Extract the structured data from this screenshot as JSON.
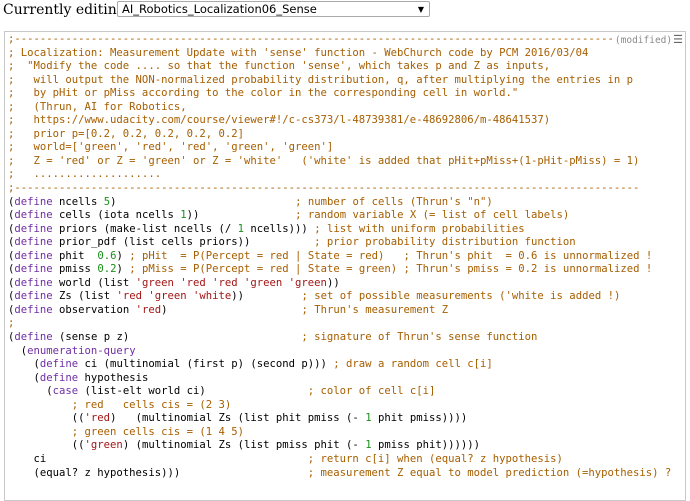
{
  "header": {
    "label": "Currently editing:",
    "selected_file": "AI_Robotics_Localization06_Sense",
    "dropdown_arrow": "▼"
  },
  "editor": {
    "status": "(modified)",
    "menu_icon": "hamburger-menu-icon",
    "menu_glyph": "☰",
    "colors": {
      "comment": "#a65e00",
      "keyword": "#6f2ea3",
      "number": "#1a8f1a",
      "quoted": "#a31515",
      "text": "#000000"
    },
    "lines": [
      [
        [
          "c",
          ";----------------------------------------------------------------------------------------------"
        ]
      ],
      [
        [
          "c",
          "; Localization: Measurement Update with 'sense' function - WebChurch code by PCM 2016/03/04"
        ]
      ],
      [
        [
          "c",
          ";  \"Modify the code .... so that the function 'sense', which takes p and Z as inputs,"
        ]
      ],
      [
        [
          "c",
          ";   will output the NON-normalized probability distribution, q, after multiplying the entries in p"
        ]
      ],
      [
        [
          "c",
          ";   by pHit or pMiss according to the color in the corresponding cell in world.\""
        ]
      ],
      [
        [
          "c",
          ";   (Thrun, AI for Robotics,"
        ]
      ],
      [
        [
          "c",
          ";   https://www.udacity.com/course/viewer#!/c-cs373/l-48739381/e-48692806/m-48641537)"
        ]
      ],
      [
        [
          "c",
          ";   prior p=[0.2, 0.2, 0.2, 0.2, 0.2]"
        ]
      ],
      [
        [
          "c",
          ";   world=['green', 'red', 'red', 'green', 'green']"
        ]
      ],
      [
        [
          "c",
          ";   Z = 'red' or Z = 'green' or Z = 'white'   ('white' is added that pHit+pMiss+(1-pHit-pMiss) = 1)"
        ]
      ],
      [
        [
          "c",
          ";   ...................."
        ]
      ],
      [
        [
          "c",
          ";--------------------------------------------------------------------------------------------------"
        ]
      ],
      [
        [
          "t",
          "("
        ],
        [
          "k",
          "define"
        ],
        [
          "t",
          " ncells "
        ],
        [
          "n",
          "5"
        ],
        [
          "t",
          ")                            "
        ],
        [
          "c",
          "; number of cells (Thrun's \"n\")"
        ]
      ],
      [
        [
          "t",
          "("
        ],
        [
          "k",
          "define"
        ],
        [
          "t",
          " cells (iota ncells "
        ],
        [
          "n",
          "1"
        ],
        [
          "t",
          "))               "
        ],
        [
          "c",
          "; random variable X (= list of cell labels)"
        ]
      ],
      [
        [
          "t",
          "("
        ],
        [
          "k",
          "define"
        ],
        [
          "t",
          " priors (make-list ncells (/ "
        ],
        [
          "n",
          "1"
        ],
        [
          "t",
          " ncells))) "
        ],
        [
          "c",
          "; list with uniform probabilities"
        ]
      ],
      [
        [
          "t",
          "("
        ],
        [
          "k",
          "define"
        ],
        [
          "t",
          " prior_pdf (list cells priors))          "
        ],
        [
          "c",
          "; prior probability distribution function"
        ]
      ],
      [
        [
          "t",
          "("
        ],
        [
          "k",
          "define"
        ],
        [
          "t",
          " phit  "
        ],
        [
          "n",
          "0.6"
        ],
        [
          "t",
          ") "
        ],
        [
          "c",
          "; pHit  = P(Percept = red | State = red)   ; Thrun's phit  = 0.6 is unnormalized !"
        ]
      ],
      [
        [
          "t",
          "("
        ],
        [
          "k",
          "define"
        ],
        [
          "t",
          " pmiss "
        ],
        [
          "n",
          "0.2"
        ],
        [
          "t",
          ") "
        ],
        [
          "c",
          "; pMiss = P(Percept = red | State = green) ; Thrun's pmiss = 0.2 is unnormalized !"
        ]
      ],
      [
        [
          "t",
          "("
        ],
        [
          "k",
          "define"
        ],
        [
          "t",
          " world (list "
        ],
        [
          "q",
          "'green 'red 'red 'green 'green"
        ],
        [
          "t",
          "))"
        ]
      ],
      [
        [
          "t",
          "("
        ],
        [
          "k",
          "define"
        ],
        [
          "t",
          " Zs (list "
        ],
        [
          "q",
          "'red 'green 'white"
        ],
        [
          "t",
          "))         "
        ],
        [
          "c",
          "; set of possible measurements ('white is added !)"
        ]
      ],
      [
        [
          "t",
          "("
        ],
        [
          "k",
          "define"
        ],
        [
          "t",
          " observation "
        ],
        [
          "q",
          "'red"
        ],
        [
          "t",
          ")                     "
        ],
        [
          "c",
          "; Thrun's measurement Z"
        ]
      ],
      [
        [
          "c",
          ";"
        ]
      ],
      [
        [
          "t",
          "("
        ],
        [
          "k",
          "define"
        ],
        [
          "t",
          " (sense p z)                           "
        ],
        [
          "c",
          "; signature of Thrun's sense function"
        ]
      ],
      [
        [
          "t",
          "  ("
        ],
        [
          "k",
          "enumeration-query"
        ]
      ],
      [
        [
          "t",
          "    ("
        ],
        [
          "k",
          "define"
        ],
        [
          "t",
          " ci (multinomial (first p) (second p))) "
        ],
        [
          "c",
          "; draw a random cell c[i]"
        ]
      ],
      [
        [
          "t",
          "    ("
        ],
        [
          "k",
          "define"
        ],
        [
          "t",
          " hypothesis"
        ]
      ],
      [
        [
          "t",
          "      ("
        ],
        [
          "k",
          "case"
        ],
        [
          "t",
          " (list-elt world ci)                "
        ],
        [
          "c",
          "; color of cell c[i]"
        ]
      ],
      [
        [
          "t",
          "          "
        ],
        [
          "c",
          "; red   cells cis = (2 3)"
        ]
      ],
      [
        [
          "t",
          "          (("
        ],
        [
          "q",
          "'red"
        ],
        [
          "t",
          ")   (multinomial Zs (list phit pmiss (- "
        ],
        [
          "n",
          "1"
        ],
        [
          "t",
          " phit pmiss))))"
        ]
      ],
      [
        [
          "t",
          "          "
        ],
        [
          "c",
          "; green cells cis = (1 4 5)"
        ]
      ],
      [
        [
          "t",
          "          (("
        ],
        [
          "q",
          "'green"
        ],
        [
          "t",
          ") (multinomial Zs (list pmiss phit (- "
        ],
        [
          "n",
          "1"
        ],
        [
          "t",
          " pmiss phit))))))"
        ]
      ],
      [
        [
          "t",
          "    ci                                         "
        ],
        [
          "c",
          "; return c[i] when (equal? z hypothesis)"
        ]
      ],
      [
        [
          "t",
          "    (equal? z hypothesis)))                    "
        ],
        [
          "c",
          "; measurement Z equal to model prediction (=hypothesis) ?"
        ]
      ],
      [
        [
          "t",
          "  "
        ]
      ]
    ]
  }
}
